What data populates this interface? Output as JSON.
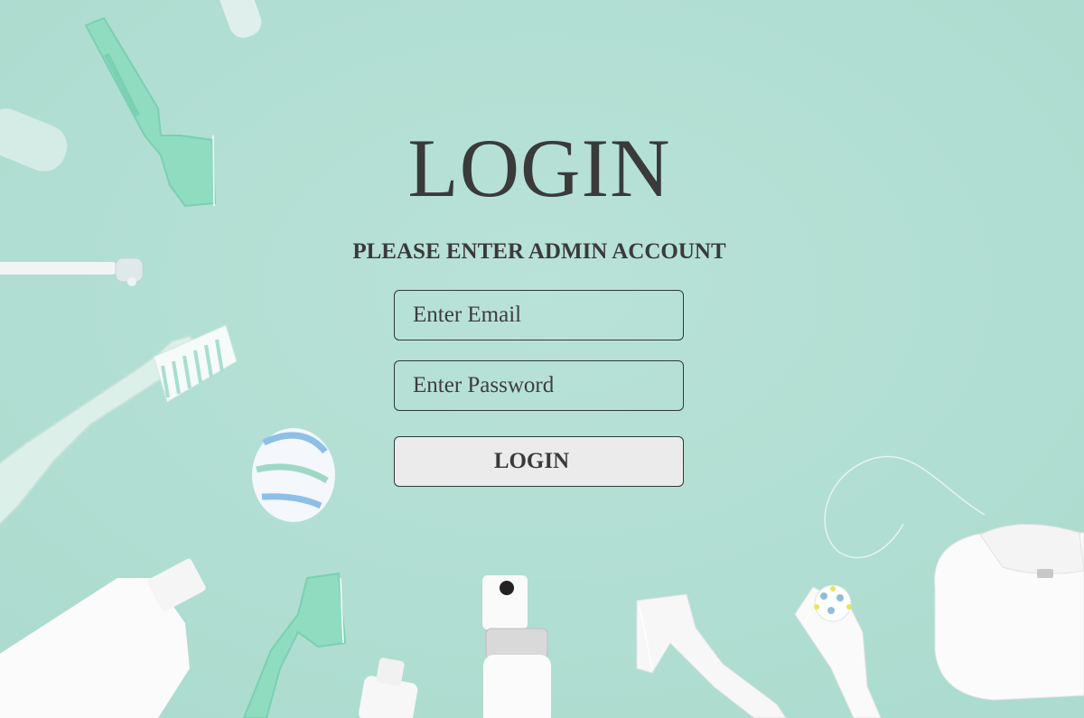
{
  "page": {
    "title": "LOGIN",
    "subtitle": "PLEASE ENTER ADMIN ACCOUNT"
  },
  "form": {
    "email_placeholder": "Enter Email",
    "password_placeholder": "Enter Password",
    "submit_label": "LOGIN"
  },
  "theme": {
    "background": "#b5dfd5",
    "text": "#3a3a3a",
    "button_bg": "#ebebeb"
  },
  "background_items": [
    "floss-pick",
    "toothbrush",
    "electric-toothbrush-head",
    "toothpaste-tube",
    "spray-bottle",
    "toothpaste-swirl",
    "floss-container",
    "interdental-brush"
  ]
}
